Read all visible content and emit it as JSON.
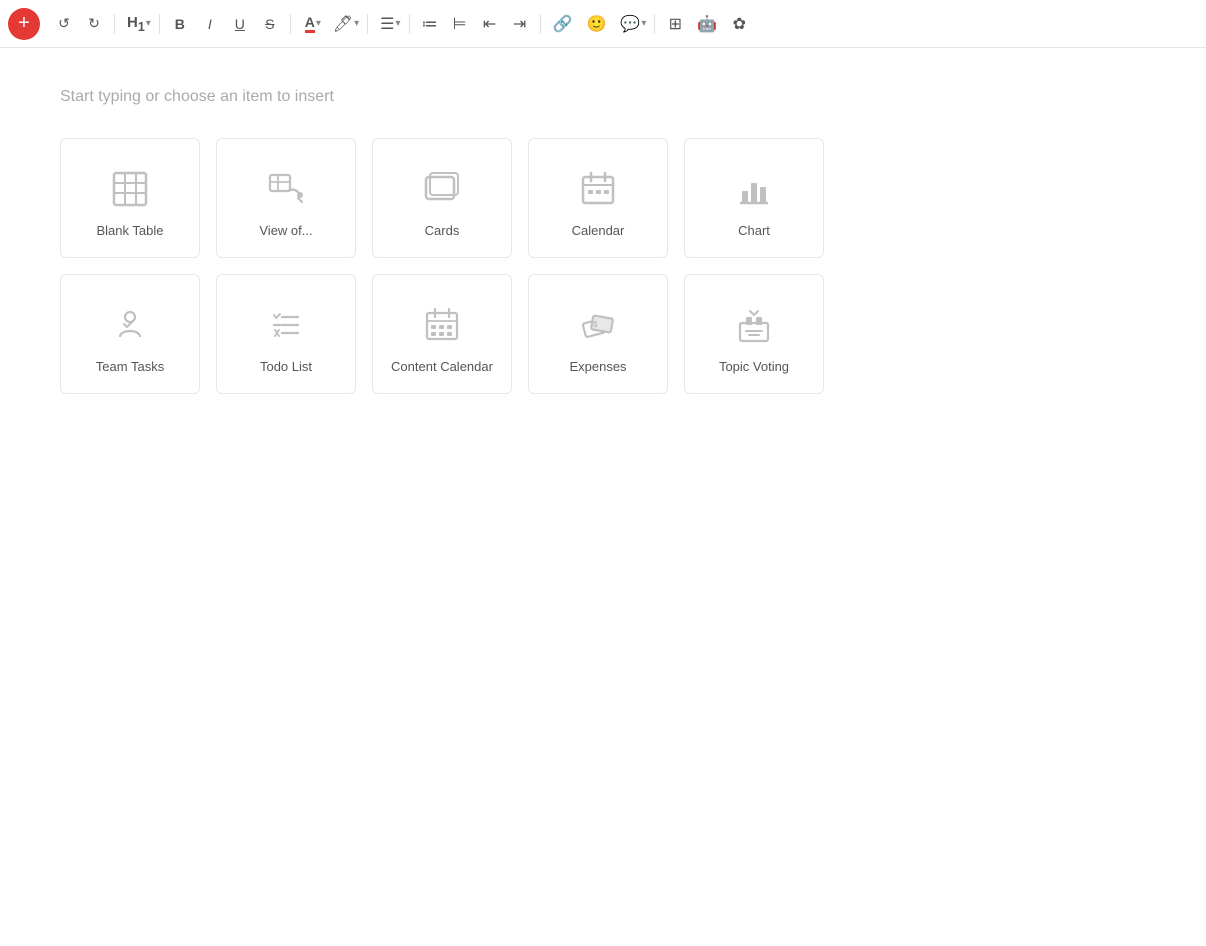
{
  "toolbar": {
    "add_label": "+",
    "undo_label": "↺",
    "redo_label": "↻",
    "heading_label": "H₁",
    "bold_label": "B",
    "italic_label": "I",
    "underline_label": "U",
    "strike_label": "S",
    "font_color_label": "A",
    "highlight_label": "✦",
    "align_label": "≡",
    "bullet_label": "≔",
    "numbered_label": "≒",
    "outdent_label": "⇤",
    "indent_label": "⇥",
    "link_label": "🔗",
    "emoji_label": "☺",
    "comment_label": "💬",
    "table_view_label": "⊞",
    "bot_label": "🤖",
    "share_label": "✿",
    "placeholder": "Start typing or choose an item to insert"
  },
  "grid": {
    "items": [
      {
        "id": "blank-table",
        "label": "Blank Table"
      },
      {
        "id": "view-of",
        "label": "View of..."
      },
      {
        "id": "cards",
        "label": "Cards"
      },
      {
        "id": "calendar",
        "label": "Calendar"
      },
      {
        "id": "chart",
        "label": "Chart"
      },
      {
        "id": "team-tasks",
        "label": "Team Tasks"
      },
      {
        "id": "todo-list",
        "label": "Todo List"
      },
      {
        "id": "content-calendar",
        "label": "Content Calendar"
      },
      {
        "id": "expenses",
        "label": "Expenses"
      },
      {
        "id": "topic-voting",
        "label": "Topic Voting"
      }
    ]
  }
}
